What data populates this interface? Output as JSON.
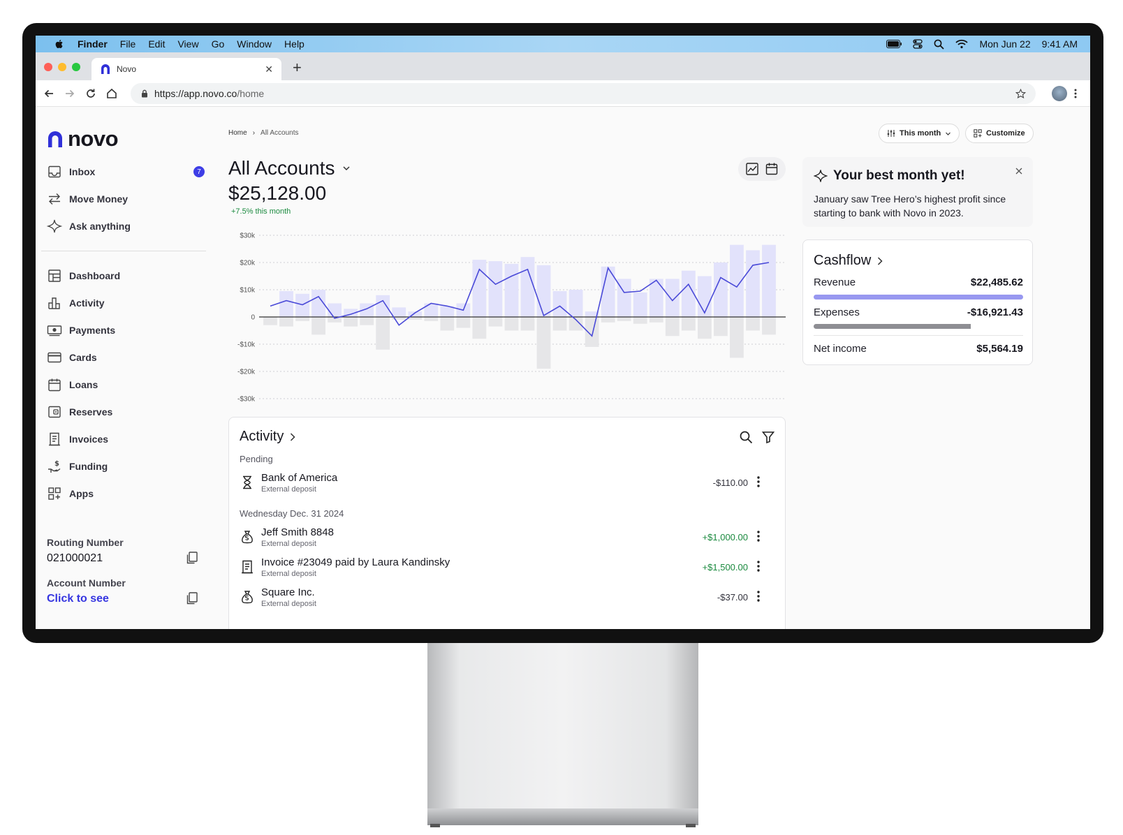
{
  "menubar": {
    "items": [
      "Finder",
      "File",
      "Edit",
      "View",
      "Go",
      "Window",
      "Help"
    ],
    "date": "Mon Jun 22",
    "time": "9:41 AM"
  },
  "browser": {
    "tab_title": "Novo",
    "url_host": "https://app.novo.co",
    "url_path": "/home"
  },
  "sidebar": {
    "logo": "novo",
    "top_items": [
      {
        "label": "Inbox",
        "icon": "inbox-icon",
        "badge": "7"
      },
      {
        "label": "Move Money",
        "icon": "transfer-arrows-icon"
      },
      {
        "label": "Ask anything",
        "icon": "sparkle-icon"
      }
    ],
    "items": [
      {
        "label": "Dashboard",
        "icon": "dashboard-icon"
      },
      {
        "label": "Activity",
        "icon": "bar-chart-icon"
      },
      {
        "label": "Payments",
        "icon": "cash-icon"
      },
      {
        "label": "Cards",
        "icon": "card-icon"
      },
      {
        "label": "Loans",
        "icon": "calendar-icon"
      },
      {
        "label": "Reserves",
        "icon": "wallet-icon"
      },
      {
        "label": "Invoices",
        "icon": "invoice-icon"
      },
      {
        "label": "Funding",
        "icon": "hand-dollar-icon"
      },
      {
        "label": "Apps",
        "icon": "apps-grid-icon"
      }
    ],
    "routing_label": "Routing Number",
    "routing_value": "021000021",
    "account_label": "Account Number",
    "account_value": "Click to see"
  },
  "main": {
    "breadcrumb": [
      "Home",
      "All Accounts"
    ],
    "period_button": "This month",
    "customize_button": "Customize",
    "title": "All Accounts",
    "balance": "$25,128.00",
    "delta": "+7.5% this month"
  },
  "chart_data": {
    "type": "bar",
    "title": "",
    "y_ticks": [
      "$30k",
      "$20k",
      "$10k",
      "0",
      "-$10k",
      "-$20k",
      "-$30k"
    ],
    "ylim": [
      -30000,
      30000
    ],
    "grid": true,
    "series": [
      {
        "values": [
          9500,
          8500,
          10000,
          5000,
          3000,
          5000,
          8000,
          3500,
          2000,
          5000,
          4000,
          5000,
          21000,
          20500,
          19500,
          22000,
          19000,
          9500,
          10000,
          2000,
          18500,
          14000,
          9000,
          14000,
          14000,
          17000,
          15000,
          20000,
          26500,
          24500,
          26500
        ]
      },
      {
        "values": [
          -3000,
          -3500,
          -1500,
          -6500,
          -2000,
          -3500,
          -3000,
          -12000,
          -1000,
          -1000,
          -1500,
          -5000,
          -4000,
          -8000,
          -3500,
          -5000,
          -5000,
          -19000,
          -5000,
          -5000,
          -11000,
          -2000,
          -1500,
          -2500,
          -2000,
          -7000,
          -5000,
          -8000,
          -7000,
          -15000,
          -5000,
          -6500
        ]
      },
      {
        "values": [
          4000,
          6000,
          4500,
          7500,
          -500,
          1000,
          3000,
          6000,
          -3000,
          1500,
          5000,
          4000,
          2500,
          17500,
          12000,
          15000,
          17500,
          500,
          4000,
          -1000,
          -7000,
          18000,
          9000,
          9500,
          13500,
          6000,
          12000,
          1500,
          14500,
          11000,
          19000,
          20000
        ]
      }
    ]
  },
  "activity": {
    "title": "Activity",
    "groups": [
      {
        "label": "Pending",
        "rows": [
          {
            "name": "Bank of America",
            "sub": "External deposit",
            "amount": "-$110.00",
            "icon": "hourglass-icon",
            "positive": false
          }
        ]
      },
      {
        "label": "Wednesday Dec. 31 2024",
        "rows": [
          {
            "name": "Jeff Smith 8848",
            "sub": "External deposit",
            "amount": "+$1,000.00",
            "icon": "money-bag-icon",
            "positive": true
          },
          {
            "name": "Invoice #23049 paid by Laura Kandinsky",
            "sub": "External deposit",
            "amount": "+$1,500.00",
            "icon": "invoice-icon",
            "positive": true
          },
          {
            "name": "Square Inc.",
            "sub": "External deposit",
            "amount": "-$37.00",
            "icon": "money-bag-icon",
            "positive": false
          }
        ]
      }
    ]
  },
  "promo": {
    "title": "Your best month yet!",
    "body": "January saw Tree Hero’s highest profit since starting to bank with Novo in 2023."
  },
  "cashflow": {
    "title": "Cashflow",
    "revenue_label": "Revenue",
    "revenue_value": "$22,485.62",
    "revenue_fill": 1.0,
    "expenses_label": "Expenses",
    "expenses_value": "-$16,921.43",
    "expenses_fill": 0.75,
    "net_label": "Net income",
    "net_value": "$5,564.19"
  },
  "colors": {
    "accent": "#3d3de6",
    "bar_positive": "#e2e2fb",
    "bar_negative": "#e6e6e8",
    "line": "#4a4ad8",
    "positive_text": "#1b8a3f",
    "revenue_bar": "#9898f0",
    "expenses_bar": "#8e8e93"
  }
}
